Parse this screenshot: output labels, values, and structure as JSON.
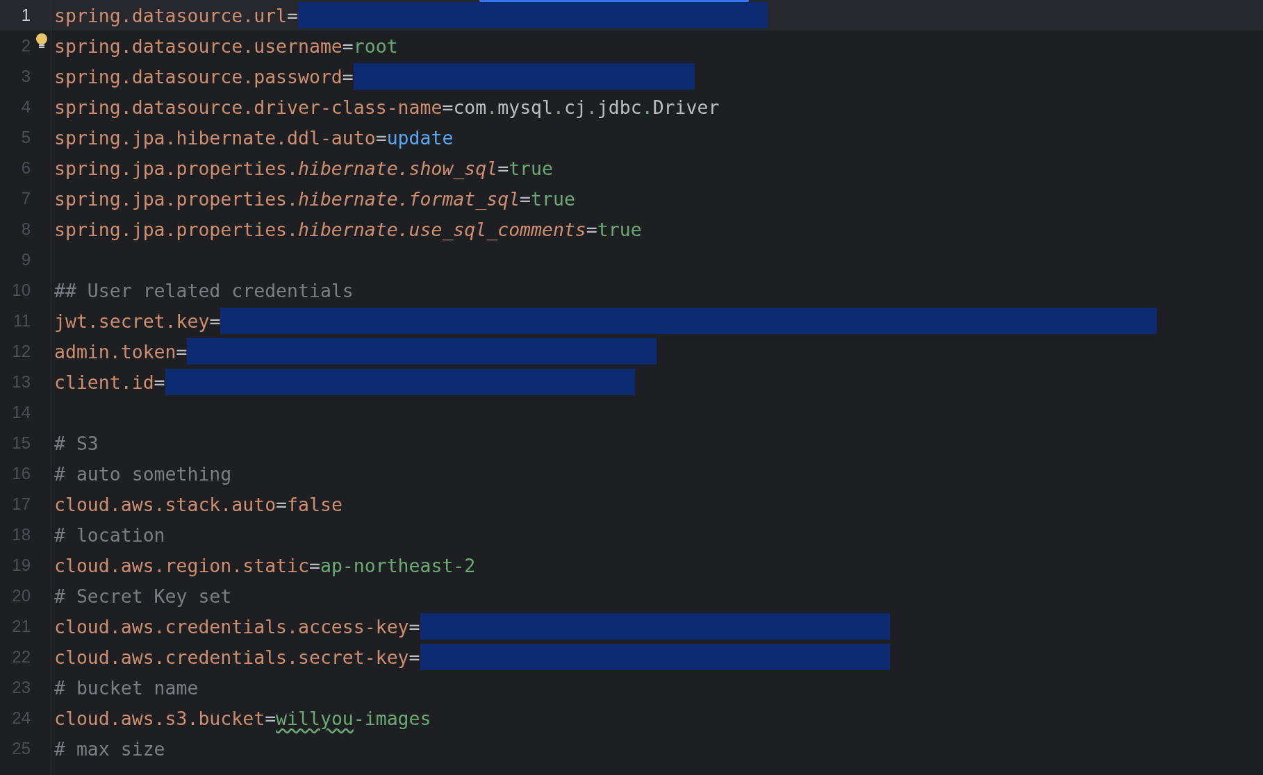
{
  "editor": {
    "lines": [
      {
        "number": "1",
        "current": true,
        "bulb": false,
        "segments": [
          {
            "kind": "key",
            "text": "spring.datasource.url"
          },
          {
            "kind": "sep",
            "text": "="
          },
          {
            "kind": "mask"
          }
        ]
      },
      {
        "number": "2",
        "current": false,
        "bulb": true,
        "segments": [
          {
            "kind": "key",
            "text": "spring.datasource.username"
          },
          {
            "kind": "sep",
            "text": "="
          },
          {
            "kind": "value",
            "text": "root"
          }
        ]
      },
      {
        "number": "3",
        "current": false,
        "bulb": false,
        "segments": [
          {
            "kind": "key",
            "text": "spring.datasource.password"
          },
          {
            "kind": "sep",
            "text": "="
          },
          {
            "kind": "shortmask"
          }
        ]
      },
      {
        "number": "4",
        "current": false,
        "bulb": false,
        "segments": [
          {
            "kind": "key",
            "text": "spring.datasource.driver-class-name"
          },
          {
            "kind": "sep",
            "text": "="
          },
          {
            "kind": "plain",
            "text": "com"
          },
          {
            "kind": "dot",
            "text": "."
          },
          {
            "kind": "plain",
            "text": "mysql"
          },
          {
            "kind": "dot",
            "text": "."
          },
          {
            "kind": "plain",
            "text": "cj"
          },
          {
            "kind": "dot",
            "text": "."
          },
          {
            "kind": "plain",
            "text": "jdbc"
          },
          {
            "kind": "dot",
            "text": "."
          },
          {
            "kind": "plain",
            "text": "Driver"
          }
        ]
      },
      {
        "number": "5",
        "current": false,
        "bulb": false,
        "segments": [
          {
            "kind": "key",
            "text": "spring.jpa.hibernate.ddl-auto"
          },
          {
            "kind": "sep",
            "text": "="
          },
          {
            "kind": "keyword",
            "text": "update"
          }
        ]
      },
      {
        "number": "6",
        "current": false,
        "bulb": false,
        "segments": [
          {
            "kind": "key",
            "text": "spring.jpa.properties."
          },
          {
            "kind": "italic",
            "text": "hibernate.show_sql"
          },
          {
            "kind": "sep",
            "text": "="
          },
          {
            "kind": "value",
            "text": "true"
          }
        ]
      },
      {
        "number": "7",
        "current": false,
        "bulb": false,
        "segments": [
          {
            "kind": "key",
            "text": "spring.jpa.properties."
          },
          {
            "kind": "italic",
            "text": "hibernate.format_sql"
          },
          {
            "kind": "sep",
            "text": "="
          },
          {
            "kind": "value",
            "text": "true"
          }
        ]
      },
      {
        "number": "8",
        "current": false,
        "bulb": false,
        "segments": [
          {
            "kind": "key",
            "text": "spring.jpa.properties."
          },
          {
            "kind": "italic",
            "text": "hibernate.use_sql_comments"
          },
          {
            "kind": "sep",
            "text": "="
          },
          {
            "kind": "value",
            "text": "true"
          }
        ]
      },
      {
        "number": "9",
        "current": false,
        "bulb": false
      },
      {
        "number": "10",
        "current": false,
        "bulb": false,
        "segments": [
          {
            "kind": "comment",
            "text": "## User related credentials"
          }
        ]
      },
      {
        "number": "11",
        "current": false,
        "bulb": false,
        "segments": [
          {
            "kind": "key",
            "text": "jwt.secret.key"
          },
          {
            "kind": "sep",
            "text": "="
          },
          {
            "kind": "longmask"
          }
        ]
      },
      {
        "number": "12",
        "current": false,
        "bulb": false,
        "segments": [
          {
            "kind": "key",
            "text": "admin.token"
          },
          {
            "kind": "sep",
            "text": "="
          },
          {
            "kind": "mask"
          }
        ]
      },
      {
        "number": "13",
        "current": false,
        "bulb": false,
        "segments": [
          {
            "kind": "key",
            "text": "client.id"
          },
          {
            "kind": "sep",
            "text": "="
          },
          {
            "kind": "mask"
          }
        ]
      },
      {
        "number": "14",
        "current": false,
        "bulb": false
      },
      {
        "number": "15",
        "current": false,
        "bulb": false,
        "segments": [
          {
            "kind": "comment",
            "text": "# S3"
          }
        ]
      },
      {
        "number": "16",
        "current": false,
        "bulb": false,
        "segments": [
          {
            "kind": "comment",
            "text": "# auto something"
          }
        ]
      },
      {
        "number": "17",
        "current": false,
        "bulb": false,
        "segments": [
          {
            "kind": "key",
            "text": "cloud.aws.stack.auto"
          },
          {
            "kind": "sep",
            "text": "="
          },
          {
            "kind": "key",
            "text": "false"
          }
        ]
      },
      {
        "number": "18",
        "current": false,
        "bulb": false,
        "segments": [
          {
            "kind": "comment",
            "text": "# location"
          }
        ]
      },
      {
        "number": "19",
        "current": false,
        "bulb": false,
        "segments": [
          {
            "kind": "key",
            "text": "cloud.aws.region.static"
          },
          {
            "kind": "sep",
            "text": "="
          },
          {
            "kind": "value",
            "text": "ap-northeast-2"
          }
        ]
      },
      {
        "number": "20",
        "current": false,
        "bulb": false,
        "segments": [
          {
            "kind": "comment",
            "text": "# Secret Key set"
          }
        ]
      },
      {
        "number": "21",
        "current": false,
        "bulb": false,
        "segments": [
          {
            "kind": "key",
            "text": "cloud.aws.credentials.access-key"
          },
          {
            "kind": "sep",
            "text": "="
          },
          {
            "kind": "mask"
          }
        ]
      },
      {
        "number": "22",
        "current": false,
        "bulb": false,
        "segments": [
          {
            "kind": "key",
            "text": "cloud.aws.credentials.secret-key"
          },
          {
            "kind": "sep",
            "text": "="
          },
          {
            "kind": "mask"
          }
        ]
      },
      {
        "number": "23",
        "current": false,
        "bulb": false,
        "segments": [
          {
            "kind": "comment",
            "text": "# bucket name"
          }
        ]
      },
      {
        "number": "24",
        "current": false,
        "bulb": false,
        "segments": [
          {
            "kind": "key",
            "text": "cloud.aws.s3.bucket"
          },
          {
            "kind": "sep",
            "text": "="
          },
          {
            "kind": "typo",
            "text": "willyou"
          },
          {
            "kind": "value",
            "text": "-images"
          }
        ]
      },
      {
        "number": "25",
        "current": false,
        "bulb": false,
        "segments": [
          {
            "kind": "comment",
            "text": "# max size"
          }
        ]
      }
    ]
  }
}
